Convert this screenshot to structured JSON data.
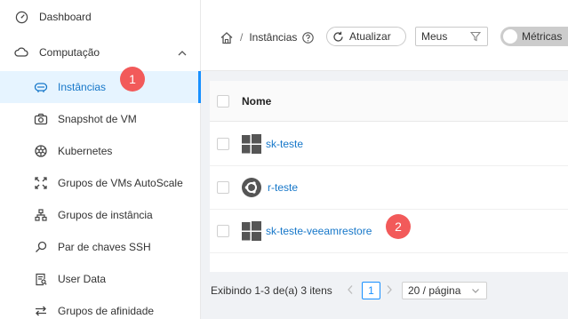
{
  "sidebar": {
    "items": [
      {
        "label": "Dashboard",
        "icon": "dashboard-icon"
      },
      {
        "label": "Computação",
        "icon": "cloud-icon"
      },
      {
        "label": "Instâncias",
        "icon": "instance-icon"
      },
      {
        "label": "Snapshot de VM",
        "icon": "camera-icon"
      },
      {
        "label": "Kubernetes",
        "icon": "kubernetes-icon"
      },
      {
        "label": "Grupos de VMs AutoScale",
        "icon": "autoscale-icon"
      },
      {
        "label": "Grupos de instância",
        "icon": "instance-group-icon"
      },
      {
        "label": "Par de chaves SSH",
        "icon": "key-icon"
      },
      {
        "label": "User Data",
        "icon": "user-data-icon"
      },
      {
        "label": "Grupos de afinidade",
        "icon": "affinity-icon"
      }
    ]
  },
  "badges": {
    "step1": "1",
    "step2": "2"
  },
  "breadcrumb": {
    "separator": "/",
    "current": "Instâncias"
  },
  "toolbar": {
    "refresh_label": "Atualizar",
    "filter_value": "Meus",
    "metrics_label": "Métricas"
  },
  "table": {
    "header_name": "Nome",
    "rows": [
      {
        "name": "sk-teste",
        "os": "windows-icon"
      },
      {
        "name": "r-teste",
        "os": "ubuntu-icon"
      },
      {
        "name": "sk-teste-veeamrestore",
        "os": "windows-icon"
      }
    ]
  },
  "pagination": {
    "summary": "Exibindo 1-3 de(a) 3 itens",
    "current_page": "1",
    "page_size": "20 / página"
  },
  "colors": {
    "accent": "#1890ff",
    "badge": "#f25a5a",
    "active_bg": "#e6f4ff"
  }
}
